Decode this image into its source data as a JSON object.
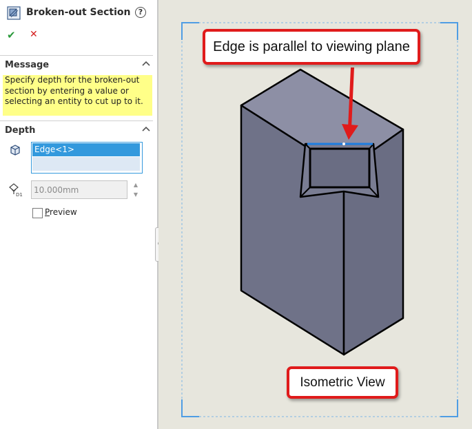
{
  "property_manager": {
    "title": "Broken-out Section",
    "help_icon": "?",
    "ok_icon": "✔",
    "cancel_icon": "✕",
    "message_group": {
      "heading": "Message",
      "lines": [
        "Specify depth for the broken-out",
        "section by entering a value or",
        "selecting an entity to cut up to it."
      ]
    },
    "depth_group": {
      "heading": "Depth",
      "selection_item": "Edge<1>",
      "depth_value": "10.000mm",
      "preview_label_accel": "P",
      "preview_label_rest": "review",
      "preview_checked": false
    }
  },
  "graphics": {
    "callout_top": "Edge is parallel to viewing plane",
    "callout_bottom": "Isometric View"
  },
  "colors": {
    "message_bg": "#ffff88",
    "selection_highlight": "#3399dd",
    "viewport_bg": "#e7e6dd",
    "model_top_face": "#8d8fa5",
    "model_side_face": "#6f7288",
    "callout_border": "#e01b1b",
    "view_boundary": "#4f9de4"
  }
}
